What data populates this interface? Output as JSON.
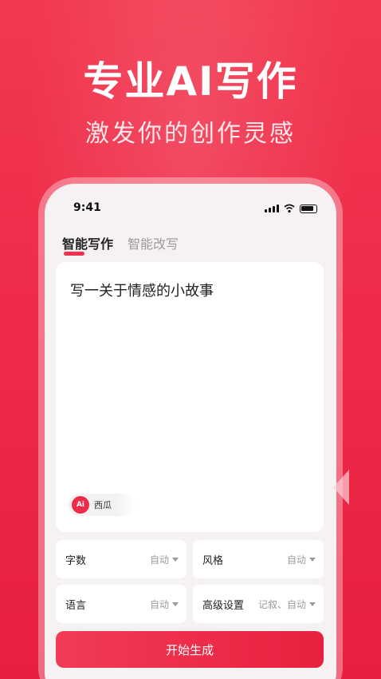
{
  "hero": {
    "title": "专业AI写作",
    "subtitle": "激发你的创作灵感"
  },
  "status_bar": {
    "time": "9:41"
  },
  "tabs": [
    {
      "label": "智能写作",
      "active": true
    },
    {
      "label": "智能改写",
      "active": false
    }
  ],
  "editor": {
    "prompt": "写一关于情感的小故事",
    "model_badge": "Ai",
    "model_label": "西瓜"
  },
  "options": {
    "word_count": {
      "label": "字数",
      "value": "自动"
    },
    "style": {
      "label": "风格",
      "value": "自动"
    },
    "language": {
      "label": "语言",
      "value": "自动"
    },
    "advanced": {
      "label": "高级设置",
      "value": "记叙、自动"
    }
  },
  "generate_button": "开始生成",
  "colors": {
    "accent": "#ee2c4a",
    "background": "#f6f2f3"
  }
}
